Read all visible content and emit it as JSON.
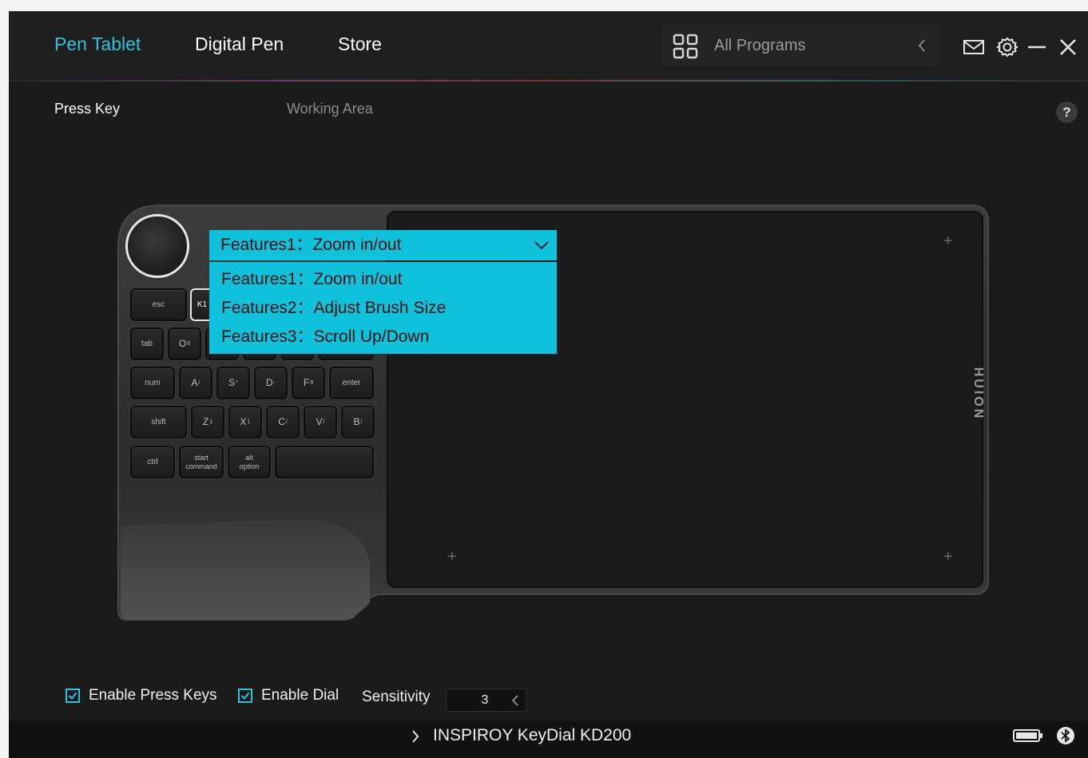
{
  "nav": {
    "tabs": [
      "Pen Tablet",
      "Digital Pen",
      "Store"
    ],
    "active_tab": "Pen Tablet"
  },
  "program_selector": {
    "label": "All Programs"
  },
  "subtabs": {
    "press_key": "Press Key",
    "working_area": "Working Area",
    "help": "?"
  },
  "dropdown": {
    "selected": "Features1：Zoom in/out",
    "options": [
      "Features1：Zoom in/out",
      "Features2：Adjust Brush Size",
      "Features3：Scroll Up/Down"
    ]
  },
  "keypad": {
    "row1": [
      "esc",
      "K1"
    ],
    "row2": [
      "tab",
      "O"
    ],
    "row3": [
      "num",
      "A",
      "S",
      "D",
      "F",
      "enter"
    ],
    "row4": [
      "shift",
      "Z",
      "X",
      "C",
      "V",
      "B"
    ],
    "row5": [
      "ctrl",
      "start command",
      "alt option",
      ""
    ]
  },
  "device_brand": "HUION",
  "options": {
    "enable_press_keys": {
      "label": "Enable Press Keys",
      "checked": true
    },
    "enable_dial": {
      "label": "Enable Dial",
      "checked": true
    },
    "sensitivity_label": "Sensitivity",
    "sensitivity_value": "3"
  },
  "status": {
    "device_name": "INSPIROY KeyDial KD200"
  },
  "colors": {
    "accent": "#2fc1dc",
    "dropdown_bg": "#10c1dc",
    "background": "#1b1b1b"
  }
}
